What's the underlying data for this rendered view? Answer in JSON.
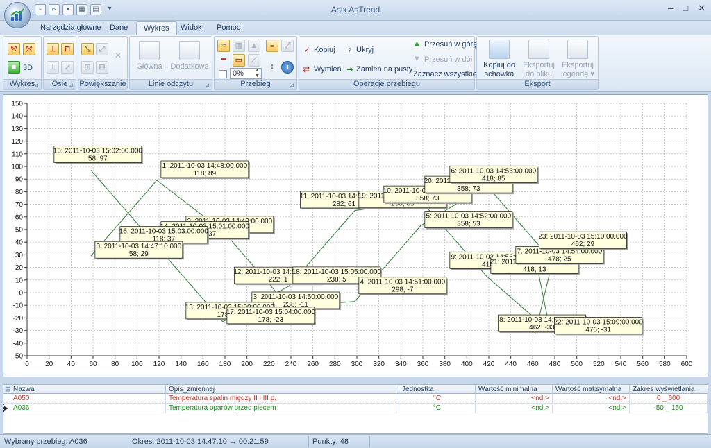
{
  "app": {
    "title": "Asix AsTrend"
  },
  "window_controls": {
    "minimize": "–",
    "maximize": "□",
    "close": "✕"
  },
  "tabs": [
    {
      "label": "Narzędzia główne"
    },
    {
      "label": "Dane"
    },
    {
      "label": "Wykres",
      "active": true
    },
    {
      "label": "Widok"
    },
    {
      "label": "Pomoc"
    }
  ],
  "ribbon": {
    "wykres": {
      "label": "Wykres",
      "btn_3d": "3D"
    },
    "osie": {
      "label": "Osie"
    },
    "powiekszanie": {
      "label": "Powiększanie"
    },
    "linie_odczytu": {
      "label": "Linie odczytu",
      "glowna": "Główna",
      "dodatkowa": "Dodatkowa"
    },
    "przebieg": {
      "label": "Przebieg",
      "percent": "0%"
    },
    "operacje": {
      "label": "Operacje przebiegu",
      "kopiuj": "Kopiuj",
      "ukryj": "Ukryj",
      "wymien": "Wymień",
      "zamien": "Zamień na pusty",
      "przesun_gore": "Przesuń w górę",
      "przesun_dol": "Przesuń w dół",
      "zaznacz": "Zaznacz wszystkie"
    },
    "eksport": {
      "label": "Eksport",
      "kopiuj_1": "Kopiuj do",
      "kopiuj_2": "schowka",
      "eksp_plik_1": "Eksportuj",
      "eksp_plik_2": "do pliku",
      "eksp_leg_1": "Eksportuj",
      "eksp_leg_2": "legendę"
    }
  },
  "colors": {
    "series_line": "#2e7d32",
    "grid": "#b0b0b0",
    "tooltip_bg": "#ffffe0",
    "row_a050": "#c0392b",
    "row_a036": "#1e8a1e"
  },
  "chart_data": {
    "type": "line",
    "xlim": [
      0,
      600
    ],
    "ylim": [
      -50,
      150
    ],
    "x_ticks": [
      0,
      20,
      40,
      60,
      80,
      100,
      120,
      140,
      160,
      180,
      200,
      220,
      240,
      260,
      280,
      300,
      320,
      340,
      360,
      380,
      400,
      420,
      440,
      460,
      480,
      500,
      520,
      540,
      560,
      580,
      600
    ],
    "y_ticks": [
      -50,
      -40,
      -30,
      -20,
      -10,
      0,
      10,
      20,
      30,
      40,
      50,
      60,
      70,
      80,
      90,
      100,
      110,
      120,
      130,
      140,
      150
    ],
    "grid": true,
    "series": [
      {
        "points": [
          [
            58,
            29
          ],
          [
            118,
            89
          ],
          [
            178,
            49
          ],
          [
            238,
            -11
          ],
          [
            298,
            -7
          ],
          [
            358,
            53
          ],
          [
            418,
            85
          ],
          [
            478,
            25
          ],
          [
            462,
            -33
          ]
        ]
      },
      {
        "points": [
          [
            58,
            97
          ],
          [
            118,
            37
          ],
          [
            178,
            -23
          ],
          [
            238,
            5
          ],
          [
            298,
            65
          ],
          [
            358,
            73
          ],
          [
            418,
            13
          ],
          [
            476,
            -31
          ],
          [
            462,
            29
          ]
        ]
      }
    ],
    "annotations": [
      {
        "text": "15: 2011-10-03 15:02:00.000",
        "value": "58; 97",
        "x": 58,
        "y": 97
      },
      {
        "text": "1: 2011-10-03 14:48:00.000",
        "value": "118; 89",
        "x": 118,
        "y": 89
      },
      {
        "text": "2: 2011-10-03 14:49:00.000",
        "value": "178; 49",
        "x": 178,
        "y": 49
      },
      {
        "text": "14: 2011-10-03 15:01:00.000",
        "value": "118; 37",
        "x": 118,
        "y": 37
      },
      {
        "text": "16: 2011-10-03 15:03:00.000",
        "value": "118; 37",
        "x": 118,
        "y": 37
      },
      {
        "text": "0: 2011-10-03 14:47:10.000",
        "value": "58; 29",
        "x": 58,
        "y": 29
      },
      {
        "text": "12: 2011-10-03 14:59:00.000",
        "value": "222; 1",
        "x": 222,
        "y": 1
      },
      {
        "text": "18: 2011-10-03 15:05:00.000",
        "value": "238; 5",
        "x": 238,
        "y": 5
      },
      {
        "text": "3: 2011-10-03 14:50:00.000",
        "value": "238; -11",
        "x": 238,
        "y": -11
      },
      {
        "text": "4: 2011-10-03 14:51:00.000",
        "value": "298; -7",
        "x": 298,
        "y": -7
      },
      {
        "text": "13: 2011-10-03 15:00:00.000",
        "value": "178; -23",
        "x": 178,
        "y": -23
      },
      {
        "text": "17: 2011-10-03 15:04:00.000",
        "value": "178; -23",
        "x": 178,
        "y": -23
      },
      {
        "text": "11: 2011-10-03 14:58:00.000",
        "value": "282; 61",
        "x": 282,
        "y": 61
      },
      {
        "text": "19: 2011-10-03 15:06:00.000",
        "value": "298; 65",
        "x": 298,
        "y": 65
      },
      {
        "text": "10: 2011-10-03 14:57:00.000",
        "value": "358; 73",
        "x": 358,
        "y": 73
      },
      {
        "text": "20: 2011-10-03 15:07:00.000",
        "value": "358; 73",
        "x": 358,
        "y": 73
      },
      {
        "text": "6: 2011-10-03 14:53:00.000",
        "value": "418; 85",
        "x": 418,
        "y": 85
      },
      {
        "text": "5: 2011-10-03 14:52:00.000",
        "value": "358; 53",
        "x": 358,
        "y": 53
      },
      {
        "text": "9: 2011-10-03 14:56:00.000",
        "value": "418; 13",
        "x": 418,
        "y": 13
      },
      {
        "text": "21: 2011-10-03 15:08:00.000",
        "value": "418; 13",
        "x": 418,
        "y": 13
      },
      {
        "text": "7: 2011-10-03 14:54:00.000",
        "value": "478; 25",
        "x": 478,
        "y": 25
      },
      {
        "text": "23: 2011-10-03 15:10:00.000",
        "value": "462; 29",
        "x": 462,
        "y": 29
      },
      {
        "text": "8: 2011-10-03 14:55:00.000",
        "value": "462; -33",
        "x": 462,
        "y": -33
      },
      {
        "text": "22: 2011-10-03 15:09:00.000",
        "value": "476; -31",
        "x": 476,
        "y": -31
      }
    ]
  },
  "grid": {
    "columns": [
      "Nazwa",
      "Opis_zmiennej",
      "Jednostka",
      "Wartość minimalna",
      "Wartość maksymalna",
      "Zakres wyświetlania"
    ],
    "rows": [
      {
        "name": "A050",
        "desc": "Temperatura spalin między II i III p.",
        "unit": "°C",
        "min": "<nd.>",
        "max": "<nd.>",
        "range": "0 _ 600"
      },
      {
        "name": "A036",
        "desc": "Temperatura oparów przed piecem",
        "unit": "°C",
        "min": "<nd.>",
        "max": "<nd.>",
        "range": "-50 _ 150"
      }
    ]
  },
  "status": {
    "selected": "Wybrany przebieg: A036",
    "period": "Okres: 2011-10-03 14:47:10 → 00:21:59",
    "points": "Punkty: 48"
  }
}
